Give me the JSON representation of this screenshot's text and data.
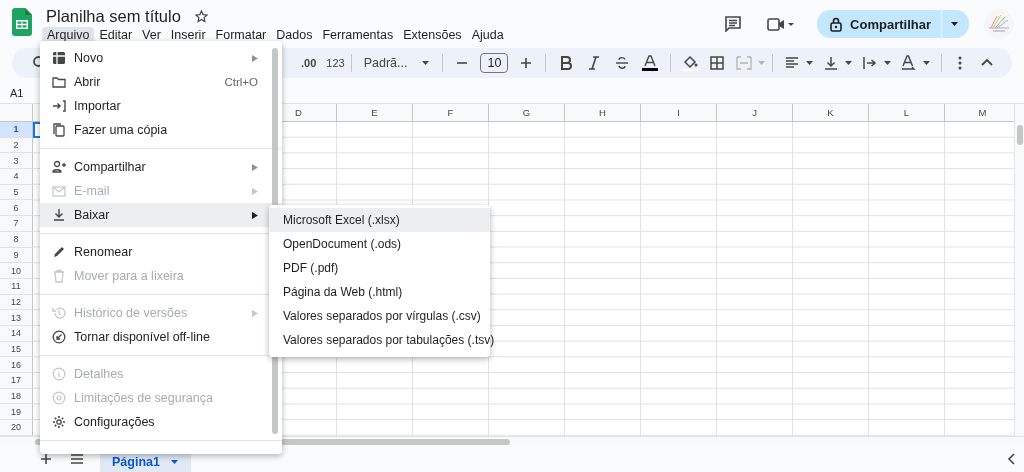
{
  "header": {
    "title": "Planilha sem título",
    "share_label": "Compartilhar",
    "menus": [
      {
        "label": "Arquivo",
        "selected": true
      },
      {
        "label": "Editar",
        "selected": false
      },
      {
        "label": "Ver",
        "selected": false
      },
      {
        "label": "Inserir",
        "selected": false
      },
      {
        "label": "Formatar",
        "selected": false
      },
      {
        "label": "Dados",
        "selected": false
      },
      {
        "label": "Ferramentas",
        "selected": false
      },
      {
        "label": "Extensões",
        "selected": false
      },
      {
        "label": "Ajuda",
        "selected": false
      }
    ]
  },
  "toolbar": {
    "decimal": ".00",
    "number_format": "123",
    "font": "Padrã...",
    "font_size": "10"
  },
  "name_box": "A1",
  "grid": {
    "columns": [
      "D",
      "E",
      "F",
      "G",
      "H",
      "I",
      "J",
      "K",
      "L",
      "M"
    ],
    "rows": [
      {
        "label": "1",
        "selected": true
      },
      {
        "label": "2",
        "selected": false
      },
      {
        "label": "3",
        "selected": false
      },
      {
        "label": "4",
        "selected": false
      },
      {
        "label": "5",
        "selected": false
      },
      {
        "label": "6",
        "selected": false
      },
      {
        "label": "7",
        "selected": false
      },
      {
        "label": "8",
        "selected": false
      },
      {
        "label": "9",
        "selected": false
      },
      {
        "label": "10",
        "selected": false
      },
      {
        "label": "11",
        "selected": false
      },
      {
        "label": "12",
        "selected": false
      },
      {
        "label": "13",
        "selected": false
      },
      {
        "label": "14",
        "selected": false
      },
      {
        "label": "15",
        "selected": false
      },
      {
        "label": "16",
        "selected": false
      },
      {
        "label": "17",
        "selected": false
      },
      {
        "label": "18",
        "selected": false
      },
      {
        "label": "19",
        "selected": false
      },
      {
        "label": "20",
        "selected": false
      }
    ]
  },
  "file_menu": {
    "groups": [
      {
        "items": [
          {
            "label": "Novo",
            "submenu": true,
            "disabled": false,
            "selected": false
          },
          {
            "label": "Abrir",
            "shortcut": "Ctrl+O",
            "submenu": false,
            "disabled": false,
            "selected": false
          },
          {
            "label": "Importar",
            "submenu": false,
            "disabled": false,
            "selected": false
          },
          {
            "label": "Fazer uma cópia",
            "submenu": false,
            "disabled": false,
            "selected": false
          }
        ]
      },
      {
        "items": [
          {
            "label": "Compartilhar",
            "submenu": true,
            "disabled": false,
            "selected": false
          },
          {
            "label": "E-mail",
            "submenu": true,
            "disabled": true,
            "selected": false
          },
          {
            "label": "Baixar",
            "submenu": true,
            "disabled": false,
            "selected": true
          }
        ]
      },
      {
        "items": [
          {
            "label": "Renomear",
            "submenu": false,
            "disabled": false,
            "selected": false
          },
          {
            "label": "Mover para a lixeira",
            "submenu": false,
            "disabled": true,
            "selected": false
          }
        ]
      },
      {
        "items": [
          {
            "label": "Histórico de versões",
            "submenu": true,
            "disabled": true,
            "selected": false
          },
          {
            "label": "Tornar disponível off-line",
            "submenu": false,
            "disabled": false,
            "selected": false
          }
        ]
      },
      {
        "items": [
          {
            "label": "Detalhes",
            "submenu": false,
            "disabled": true,
            "selected": false
          },
          {
            "label": "Limitações de segurança",
            "submenu": false,
            "disabled": true,
            "selected": false
          },
          {
            "label": "Configurações",
            "submenu": false,
            "disabled": false,
            "selected": false
          }
        ]
      }
    ]
  },
  "download_menu": {
    "items": [
      {
        "label": "Microsoft Excel (.xlsx)",
        "selected": true
      },
      {
        "label": "OpenDocument (.ods)",
        "selected": false
      },
      {
        "label": "PDF (.pdf)",
        "selected": false
      },
      {
        "label": "Página da Web (.html)",
        "selected": false
      },
      {
        "label": "Valores separados por vírgulas (.csv)",
        "selected": false
      },
      {
        "label": "Valores separados por tabulações (.tsv)",
        "selected": false
      }
    ]
  },
  "sheets": [
    {
      "label": "Página1",
      "selected": true
    }
  ]
}
